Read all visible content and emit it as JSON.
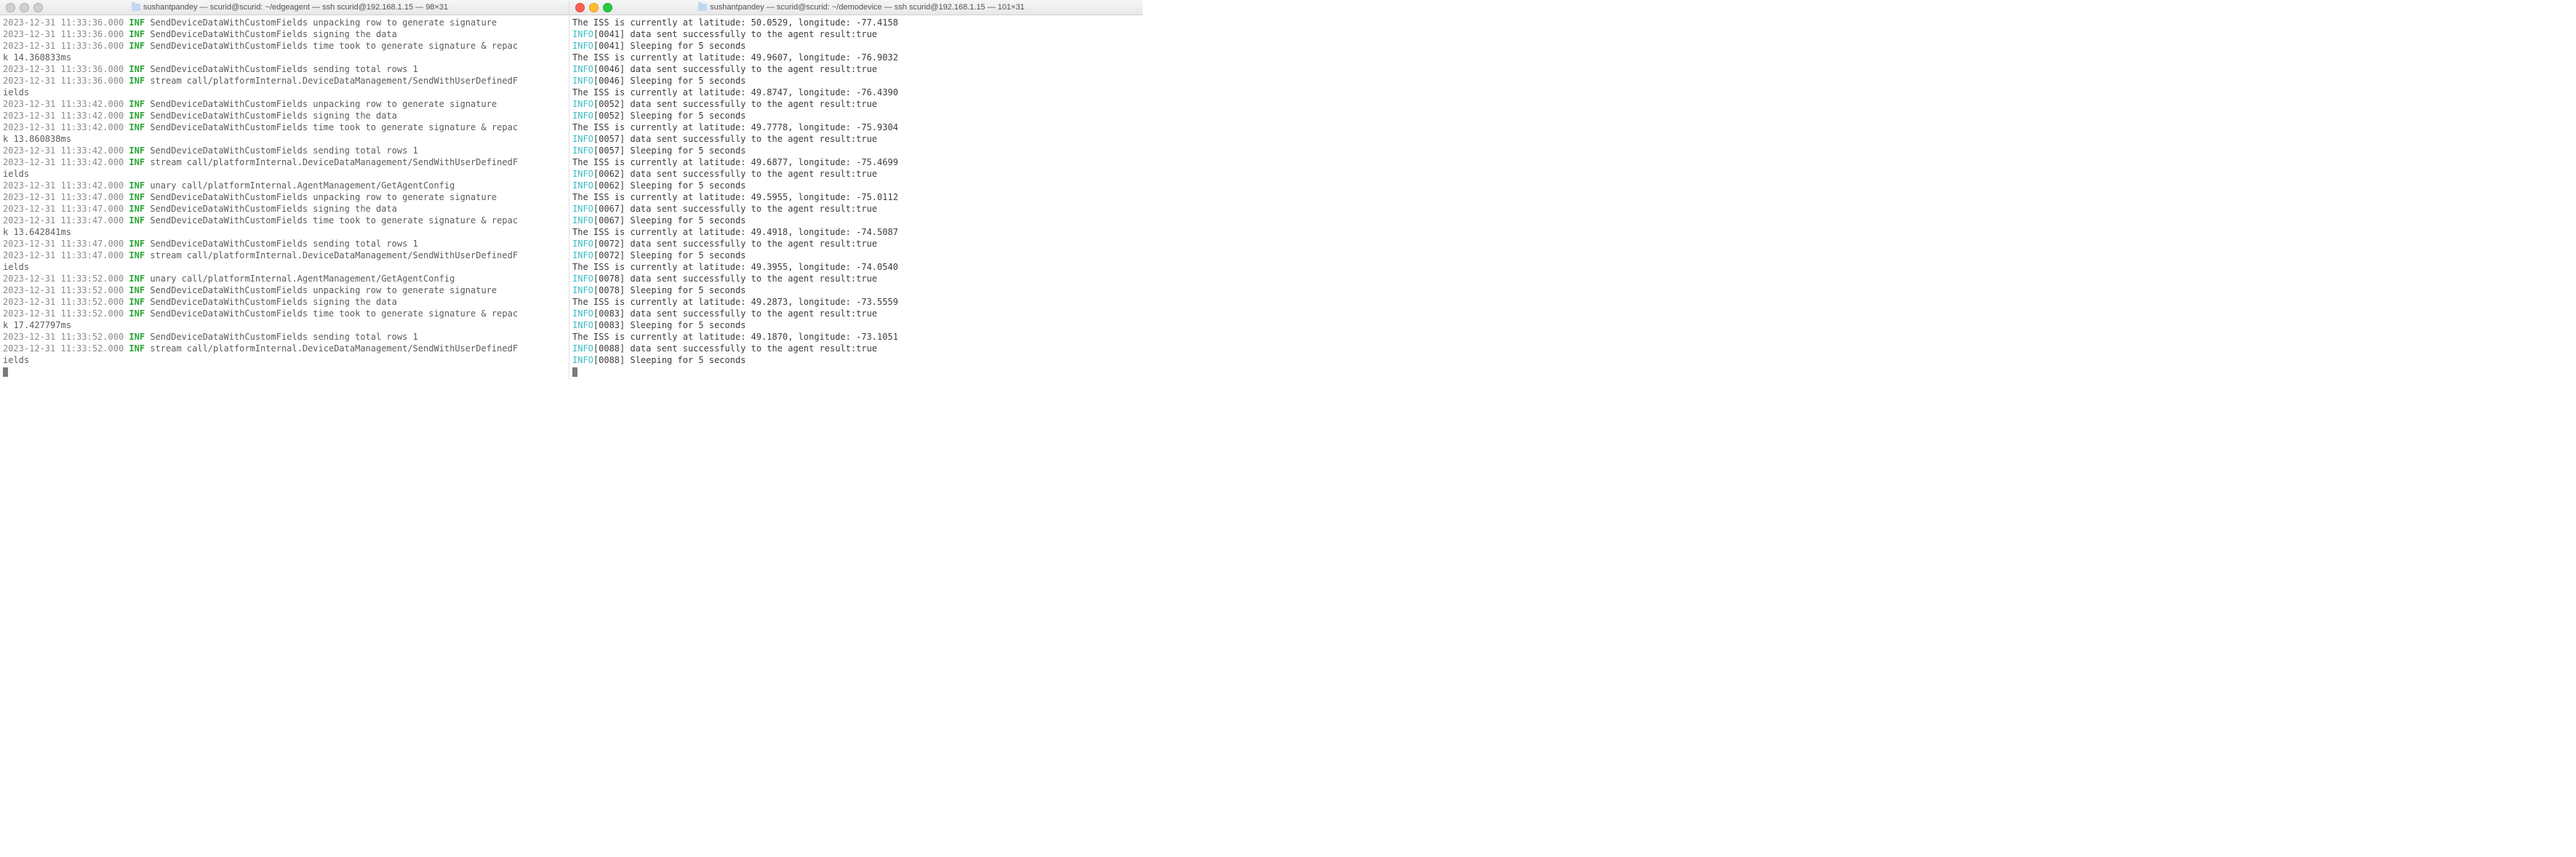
{
  "left": {
    "title": "sushantpandey — scurid@scurid: ~/edgeagent — ssh scurid@192.168.1.15 — 98×31",
    "traffic_active": false,
    "lines": [
      {
        "ts": "2023-12-31 11:33:36.000",
        "lvl": "INF",
        "msg": "SendDeviceDataWithCustomFields unpacking row to generate signature"
      },
      {
        "ts": "2023-12-31 11:33:36.000",
        "lvl": "INF",
        "msg": "SendDeviceDataWithCustomFields signing the data"
      },
      {
        "ts": "2023-12-31 11:33:36.000",
        "lvl": "INF",
        "msg": "SendDeviceDataWithCustomFields time took to generate signature & repac"
      },
      {
        "wrap": "k 14.360833ms"
      },
      {
        "ts": "2023-12-31 11:33:36.000",
        "lvl": "INF",
        "msg": "SendDeviceDataWithCustomFields sending total rows 1"
      },
      {
        "ts": "2023-12-31 11:33:36.000",
        "lvl": "INF",
        "msg": "stream call/platformInternal.DeviceDataManagement/SendWithUserDefinedF"
      },
      {
        "wrap": "ields"
      },
      {
        "ts": "2023-12-31 11:33:42.000",
        "lvl": "INF",
        "msg": "SendDeviceDataWithCustomFields unpacking row to generate signature"
      },
      {
        "ts": "2023-12-31 11:33:42.000",
        "lvl": "INF",
        "msg": "SendDeviceDataWithCustomFields signing the data"
      },
      {
        "ts": "2023-12-31 11:33:42.000",
        "lvl": "INF",
        "msg": "SendDeviceDataWithCustomFields time took to generate signature & repac"
      },
      {
        "wrap": "k 13.860838ms"
      },
      {
        "ts": "2023-12-31 11:33:42.000",
        "lvl": "INF",
        "msg": "SendDeviceDataWithCustomFields sending total rows 1"
      },
      {
        "ts": "2023-12-31 11:33:42.000",
        "lvl": "INF",
        "msg": "stream call/platformInternal.DeviceDataManagement/SendWithUserDefinedF"
      },
      {
        "wrap": "ields"
      },
      {
        "ts": "2023-12-31 11:33:42.000",
        "lvl": "INF",
        "msg": "unary call/platformInternal.AgentManagement/GetAgentConfig"
      },
      {
        "ts": "2023-12-31 11:33:47.000",
        "lvl": "INF",
        "msg": "SendDeviceDataWithCustomFields unpacking row to generate signature"
      },
      {
        "ts": "2023-12-31 11:33:47.000",
        "lvl": "INF",
        "msg": "SendDeviceDataWithCustomFields signing the data"
      },
      {
        "ts": "2023-12-31 11:33:47.000",
        "lvl": "INF",
        "msg": "SendDeviceDataWithCustomFields time took to generate signature & repac"
      },
      {
        "wrap": "k 13.642841ms"
      },
      {
        "ts": "2023-12-31 11:33:47.000",
        "lvl": "INF",
        "msg": "SendDeviceDataWithCustomFields sending total rows 1"
      },
      {
        "ts": "2023-12-31 11:33:47.000",
        "lvl": "INF",
        "msg": "stream call/platformInternal.DeviceDataManagement/SendWithUserDefinedF"
      },
      {
        "wrap": "ields"
      },
      {
        "ts": "2023-12-31 11:33:52.000",
        "lvl": "INF",
        "msg": "unary call/platformInternal.AgentManagement/GetAgentConfig"
      },
      {
        "ts": "2023-12-31 11:33:52.000",
        "lvl": "INF",
        "msg": "SendDeviceDataWithCustomFields unpacking row to generate signature"
      },
      {
        "ts": "2023-12-31 11:33:52.000",
        "lvl": "INF",
        "msg": "SendDeviceDataWithCustomFields signing the data"
      },
      {
        "ts": "2023-12-31 11:33:52.000",
        "lvl": "INF",
        "msg": "SendDeviceDataWithCustomFields time took to generate signature & repac"
      },
      {
        "wrap": "k 17.427797ms"
      },
      {
        "ts": "2023-12-31 11:33:52.000",
        "lvl": "INF",
        "msg": "SendDeviceDataWithCustomFields sending total rows 1"
      },
      {
        "ts": "2023-12-31 11:33:52.000",
        "lvl": "INF",
        "msg": "stream call/platformInternal.DeviceDataManagement/SendWithUserDefinedF"
      },
      {
        "wrap": "ields"
      },
      {
        "cursor": true
      }
    ]
  },
  "right": {
    "title": "sushantpandey — scurid@scurid: ~/demodevice — ssh scurid@192.168.1.15 — 101×31",
    "traffic_active": true,
    "lines": [
      {
        "plain": "The ISS is currently at latitude: 50.0529, longitude: -77.4158"
      },
      {
        "lvl": "INFO",
        "tag": "[0041]",
        "msg": "data sent successfully to the agent result:true"
      },
      {
        "lvl": "INFO",
        "tag": "[0041]",
        "msg": "Sleeping for 5 seconds"
      },
      {
        "plain": "The ISS is currently at latitude: 49.9607, longitude: -76.9032"
      },
      {
        "lvl": "INFO",
        "tag": "[0046]",
        "msg": "data sent successfully to the agent result:true"
      },
      {
        "lvl": "INFO",
        "tag": "[0046]",
        "msg": "Sleeping for 5 seconds"
      },
      {
        "plain": "The ISS is currently at latitude: 49.8747, longitude: -76.4390"
      },
      {
        "lvl": "INFO",
        "tag": "[0052]",
        "msg": "data sent successfully to the agent result:true"
      },
      {
        "lvl": "INFO",
        "tag": "[0052]",
        "msg": "Sleeping for 5 seconds"
      },
      {
        "plain": "The ISS is currently at latitude: 49.7778, longitude: -75.9304"
      },
      {
        "lvl": "INFO",
        "tag": "[0057]",
        "msg": "data sent successfully to the agent result:true"
      },
      {
        "lvl": "INFO",
        "tag": "[0057]",
        "msg": "Sleeping for 5 seconds"
      },
      {
        "plain": "The ISS is currently at latitude: 49.6877, longitude: -75.4699"
      },
      {
        "lvl": "INFO",
        "tag": "[0062]",
        "msg": "data sent successfully to the agent result:true"
      },
      {
        "lvl": "INFO",
        "tag": "[0062]",
        "msg": "Sleeping for 5 seconds"
      },
      {
        "plain": "The ISS is currently at latitude: 49.5955, longitude: -75.0112"
      },
      {
        "lvl": "INFO",
        "tag": "[0067]",
        "msg": "data sent successfully to the agent result:true"
      },
      {
        "lvl": "INFO",
        "tag": "[0067]",
        "msg": "Sleeping for 5 seconds"
      },
      {
        "plain": "The ISS is currently at latitude: 49.4918, longitude: -74.5087"
      },
      {
        "lvl": "INFO",
        "tag": "[0072]",
        "msg": "data sent successfully to the agent result:true"
      },
      {
        "lvl": "INFO",
        "tag": "[0072]",
        "msg": "Sleeping for 5 seconds"
      },
      {
        "plain": "The ISS is currently at latitude: 49.3955, longitude: -74.0540"
      },
      {
        "lvl": "INFO",
        "tag": "[0078]",
        "msg": "data sent successfully to the agent result:true"
      },
      {
        "lvl": "INFO",
        "tag": "[0078]",
        "msg": "Sleeping for 5 seconds"
      },
      {
        "plain": "The ISS is currently at latitude: 49.2873, longitude: -73.5559"
      },
      {
        "lvl": "INFO",
        "tag": "[0083]",
        "msg": "data sent successfully to the agent result:true"
      },
      {
        "lvl": "INFO",
        "tag": "[0083]",
        "msg": "Sleeping for 5 seconds"
      },
      {
        "plain": "The ISS is currently at latitude: 49.1870, longitude: -73.1051"
      },
      {
        "lvl": "INFO",
        "tag": "[0088]",
        "msg": "data sent successfully to the agent result:true"
      },
      {
        "lvl": "INFO",
        "tag": "[0088]",
        "msg": "Sleeping for 5 seconds"
      },
      {
        "cursor": true
      }
    ]
  }
}
